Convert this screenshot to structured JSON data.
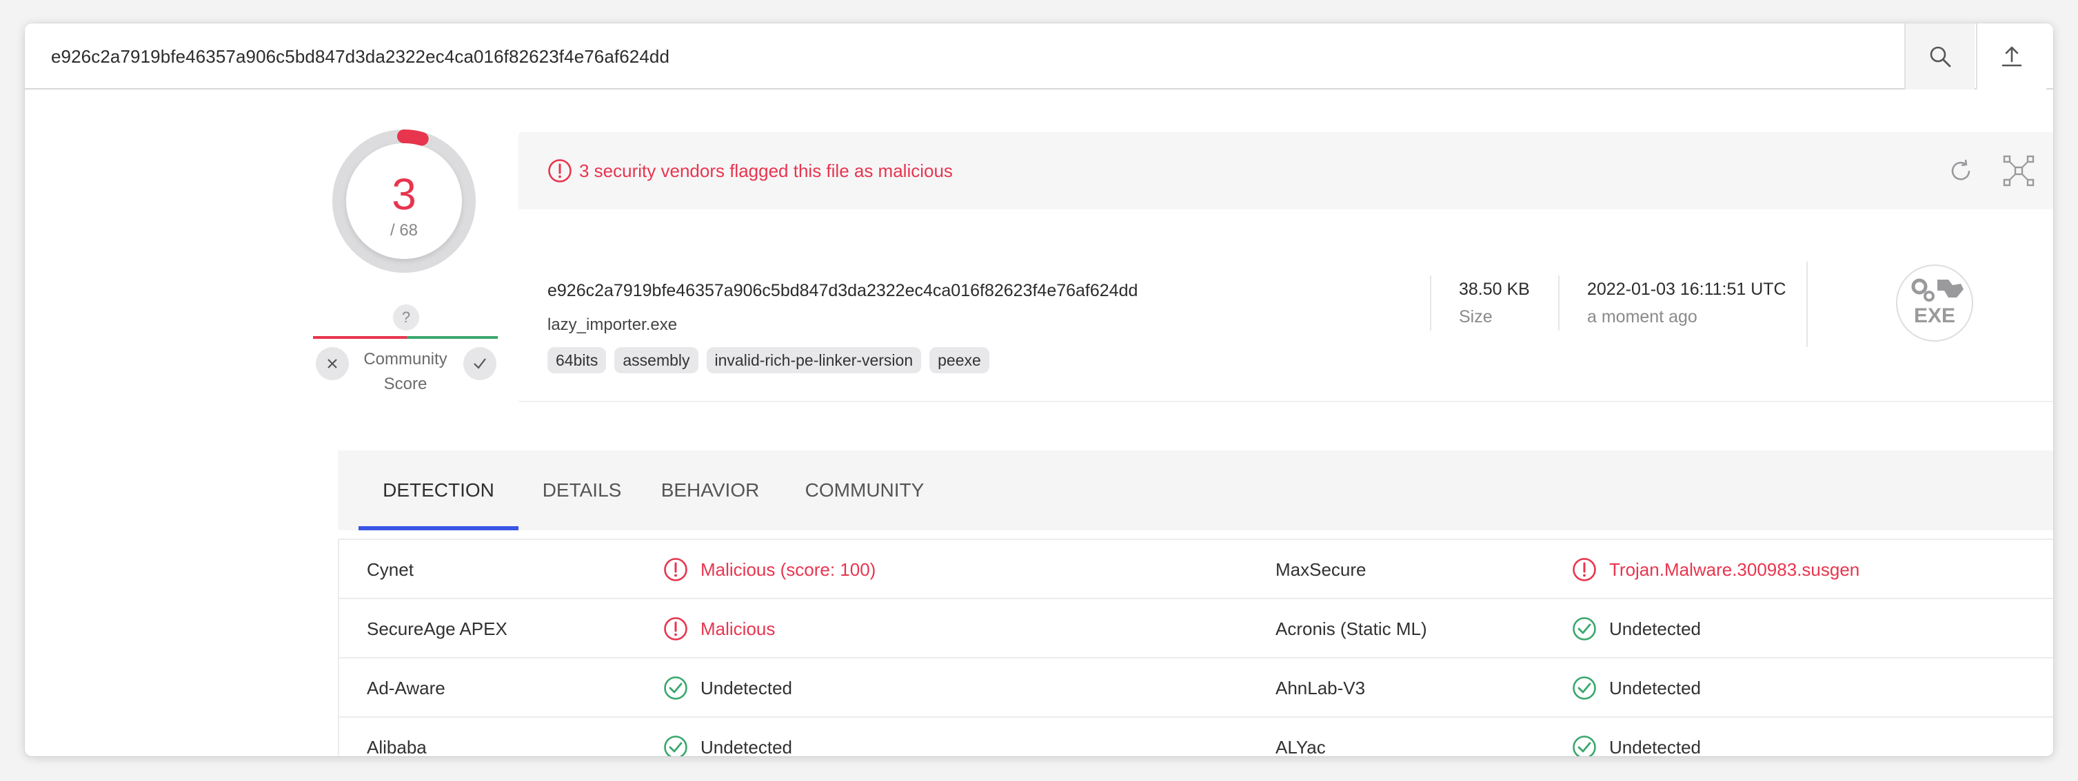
{
  "search": {
    "query": "e926c2a7919bfe46357a906c5bd847d3da2322ec4ca016f82623f4e76af624dd",
    "search_icon": "search-icon",
    "upload_icon": "upload-icon"
  },
  "score": {
    "detections": "3",
    "total": "/ 68",
    "flagged_fraction": 0.044
  },
  "community": {
    "unknown": "?",
    "label": "Community Score"
  },
  "alert": {
    "message": "3 security vendors flagged this file as malicious",
    "color": "#e8354e"
  },
  "file": {
    "hash": "e926c2a7919bfe46357a906c5bd847d3da2322ec4ca016f82623f4e76af624dd",
    "name": "lazy_importer.exe",
    "tags": [
      "64bits",
      "assembly",
      "invalid-rich-pe-linker-version",
      "peexe"
    ],
    "size_value": "38.50 KB",
    "size_label": "Size",
    "date_value": "2022-01-03 16:11:51 UTC",
    "date_label": "a moment ago",
    "type_badge": "EXE"
  },
  "tabs": [
    {
      "label": "DETECTION",
      "active": true
    },
    {
      "label": "DETAILS",
      "active": false
    },
    {
      "label": "BEHAVIOR",
      "active": false
    },
    {
      "label": "COMMUNITY",
      "active": false
    }
  ],
  "detections": [
    {
      "left_engine": "Cynet",
      "left_result": "Malicious (score: 100)",
      "left_status": "malicious",
      "right_engine": "MaxSecure",
      "right_result": "Trojan.Malware.300983.susgen",
      "right_status": "malicious"
    },
    {
      "left_engine": "SecureAge APEX",
      "left_result": "Malicious",
      "left_status": "malicious",
      "right_engine": "Acronis (Static ML)",
      "right_result": "Undetected",
      "right_status": "undetected"
    },
    {
      "left_engine": "Ad-Aware",
      "left_result": "Undetected",
      "left_status": "undetected",
      "right_engine": "AhnLab-V3",
      "right_result": "Undetected",
      "right_status": "undetected"
    },
    {
      "left_engine": "Alibaba",
      "left_result": "Undetected",
      "left_status": "undetected",
      "right_engine": "ALYac",
      "right_result": "Undetected",
      "right_status": "undetected"
    }
  ],
  "colors": {
    "malicious": "#e8354e",
    "undetected": "#3aa76d",
    "accent": "#3a56e5"
  }
}
